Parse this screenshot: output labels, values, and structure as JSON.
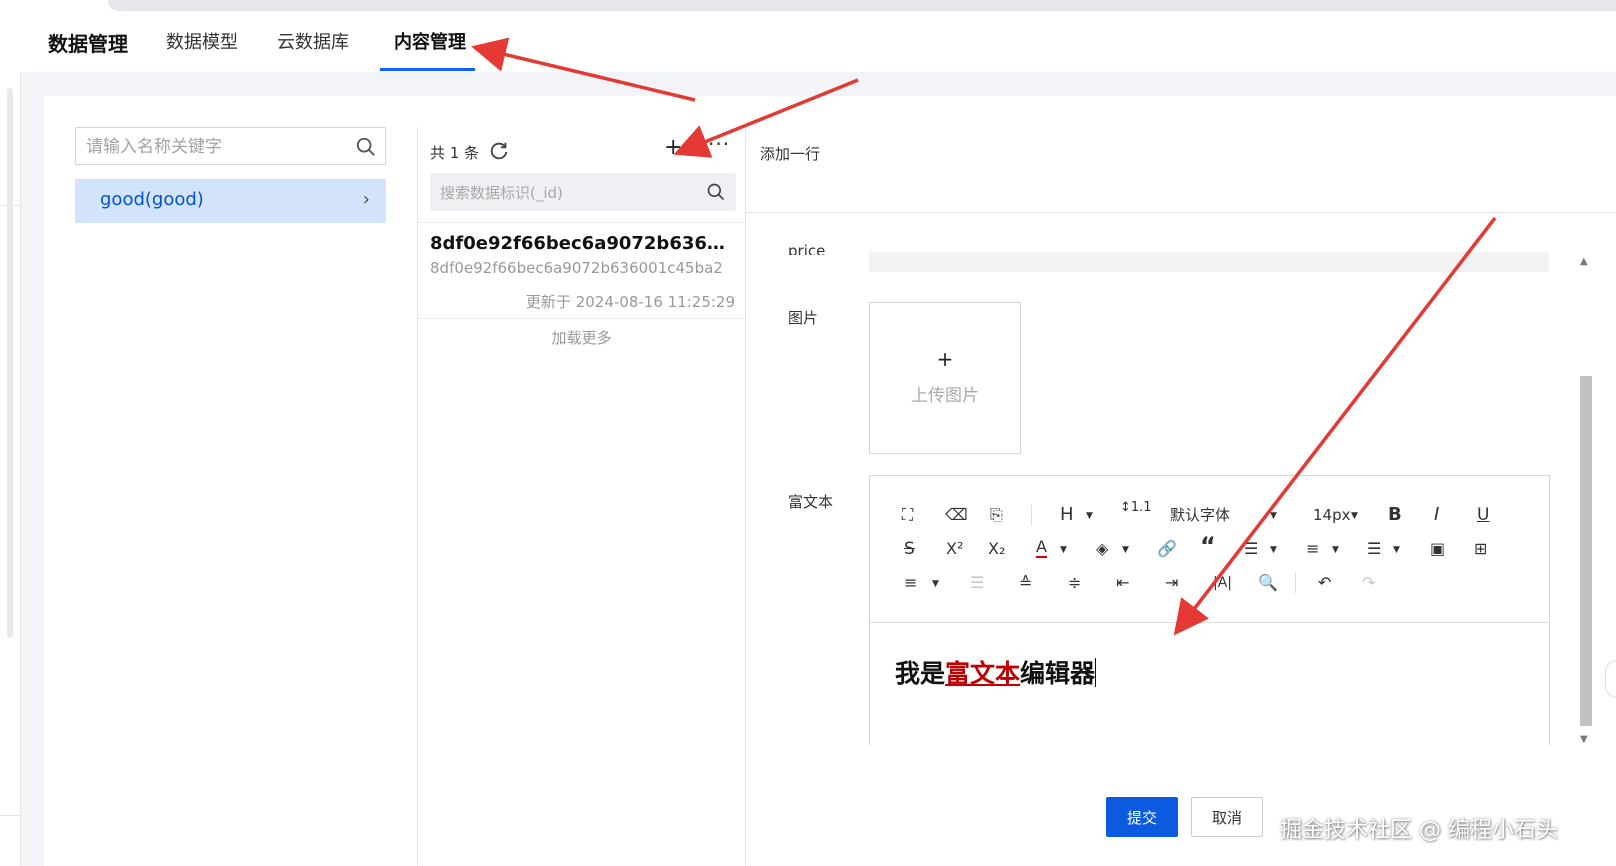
{
  "header": {
    "brand": "数据管理",
    "tabs": [
      {
        "label": "数据模型"
      },
      {
        "label": "云数据库"
      },
      {
        "label": "内容管理",
        "active": true
      }
    ]
  },
  "models": {
    "search_placeholder": "请输入名称关键字",
    "items": [
      {
        "label": "good(good)",
        "selected": true
      }
    ]
  },
  "records": {
    "count_label": "共 1 条",
    "add_icon": "plus-icon",
    "more_icon": "more-icon",
    "search_placeholder": "搜索数据标识(_id)",
    "items": [
      {
        "title": "8df0e92f66bec6a9072b636001c45ba2",
        "id": "8df0e92f66bec6a9072b636001c45ba2",
        "updated": "更新于 2024-08-16 11:25:29"
      }
    ],
    "load_more": "加载更多"
  },
  "form": {
    "header_title": "添加一行",
    "fields": {
      "price": "price",
      "image": "图片",
      "richtext": "富文本"
    },
    "upload": {
      "plus": "+",
      "label": "上传图片"
    },
    "editor": {
      "font_family": "默认字体",
      "font_size": "14px",
      "content_prefix": "我是",
      "content_highlight": "富文本",
      "content_suffix": "编辑器",
      "highlight_color": "#c00000"
    },
    "submit": "提交",
    "cancel": "取消"
  },
  "theme": {
    "accent": "#0052d9",
    "primary_button": "#0b5ae0",
    "annotation": "#e53935"
  },
  "watermark": "掘金技术社区 @ 编程小石头"
}
